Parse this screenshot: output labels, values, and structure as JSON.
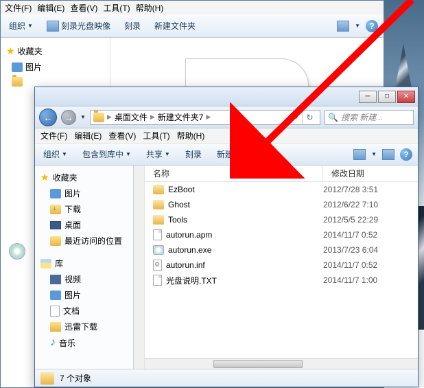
{
  "back_window": {
    "menu": {
      "file": "文件(F)",
      "edit": "编辑(E)",
      "view": "查看(V)",
      "tools": "工具(T)",
      "help": "帮助(H)"
    },
    "toolbar": {
      "organize": "组织",
      "burn_image": "刻录光盘映像",
      "burn": "刻录",
      "new_folder": "新建文件夹"
    },
    "tree": {
      "favorites": "收藏夹",
      "pictures": "图片"
    }
  },
  "front_window": {
    "breadcrumb": {
      "item1": "桌面文件",
      "item2": "新建文件夹7"
    },
    "search_placeholder": "搜索 新建...",
    "menu": {
      "file": "文件(F)",
      "edit": "编辑(E)",
      "view": "查看(V)",
      "tools": "工具(T)",
      "help": "帮助(H)"
    },
    "toolbar": {
      "organize": "组织",
      "include": "包含到库中",
      "share": "共享",
      "burn": "刻录",
      "new_folder": "新建文件夹"
    },
    "tree": {
      "favorites": "收藏夹",
      "fav_items": {
        "pictures": "图片",
        "downloads": "下载",
        "desktop": "桌面",
        "recent": "最近访问的位置"
      },
      "library": "库",
      "lib_items": {
        "videos": "视频",
        "pictures": "图片",
        "documents": "文档",
        "thunder": "迅雷下载",
        "music": "音乐"
      }
    },
    "columns": {
      "name": "名称",
      "date": "修改日期"
    },
    "files": [
      {
        "name": "EzBoot",
        "date": "2012/7/28 3:51",
        "type": "folder"
      },
      {
        "name": "Ghost",
        "date": "2012/6/22 7:10",
        "type": "folder"
      },
      {
        "name": "Tools",
        "date": "2012/5/5 22:29",
        "type": "folder"
      },
      {
        "name": "autorun.apm",
        "date": "2014/11/7 0:52",
        "type": "file"
      },
      {
        "name": "autorun.exe",
        "date": "2013/7/23 6:04",
        "type": "exe"
      },
      {
        "name": "autorun.inf",
        "date": "2014/11/7 0:52",
        "type": "inf"
      },
      {
        "name": "光盘说明.TXT",
        "date": "2014/11/7 1:00",
        "type": "file"
      }
    ],
    "status": {
      "count": "7 个对象"
    }
  }
}
